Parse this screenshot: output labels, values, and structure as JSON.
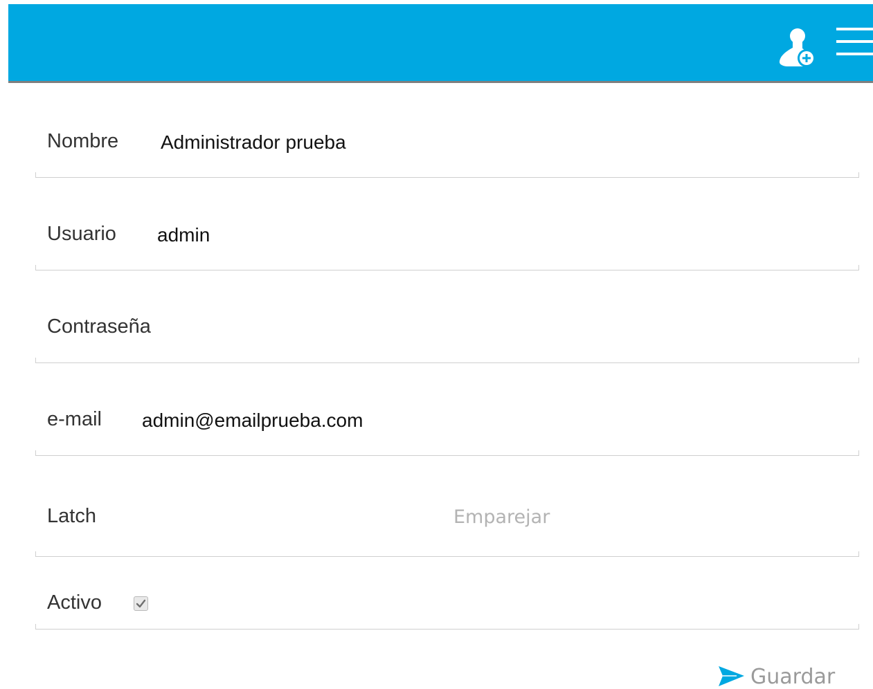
{
  "colors": {
    "header": "#00a8e1",
    "header_border": "#7f7f7f",
    "accent": "#00a8e1",
    "muted_text": "#b3b3b3"
  },
  "header": {
    "add_user_icon": "add-user-icon",
    "menu_icon": "hamburger-menu-icon"
  },
  "form": {
    "nombre": {
      "label": "Nombre",
      "value": "Administrador prueba"
    },
    "usuario": {
      "label": "Usuario",
      "value": "admin"
    },
    "password": {
      "label": "Contraseña",
      "value": ""
    },
    "email": {
      "label": "e-mail",
      "value": "admin@emailprueba.com"
    },
    "latch": {
      "label": "Latch",
      "action": "Emparejar"
    },
    "activo": {
      "label": "Activo",
      "checked": true
    }
  },
  "actions": {
    "save_label": "Guardar",
    "save_icon": "send-icon"
  }
}
